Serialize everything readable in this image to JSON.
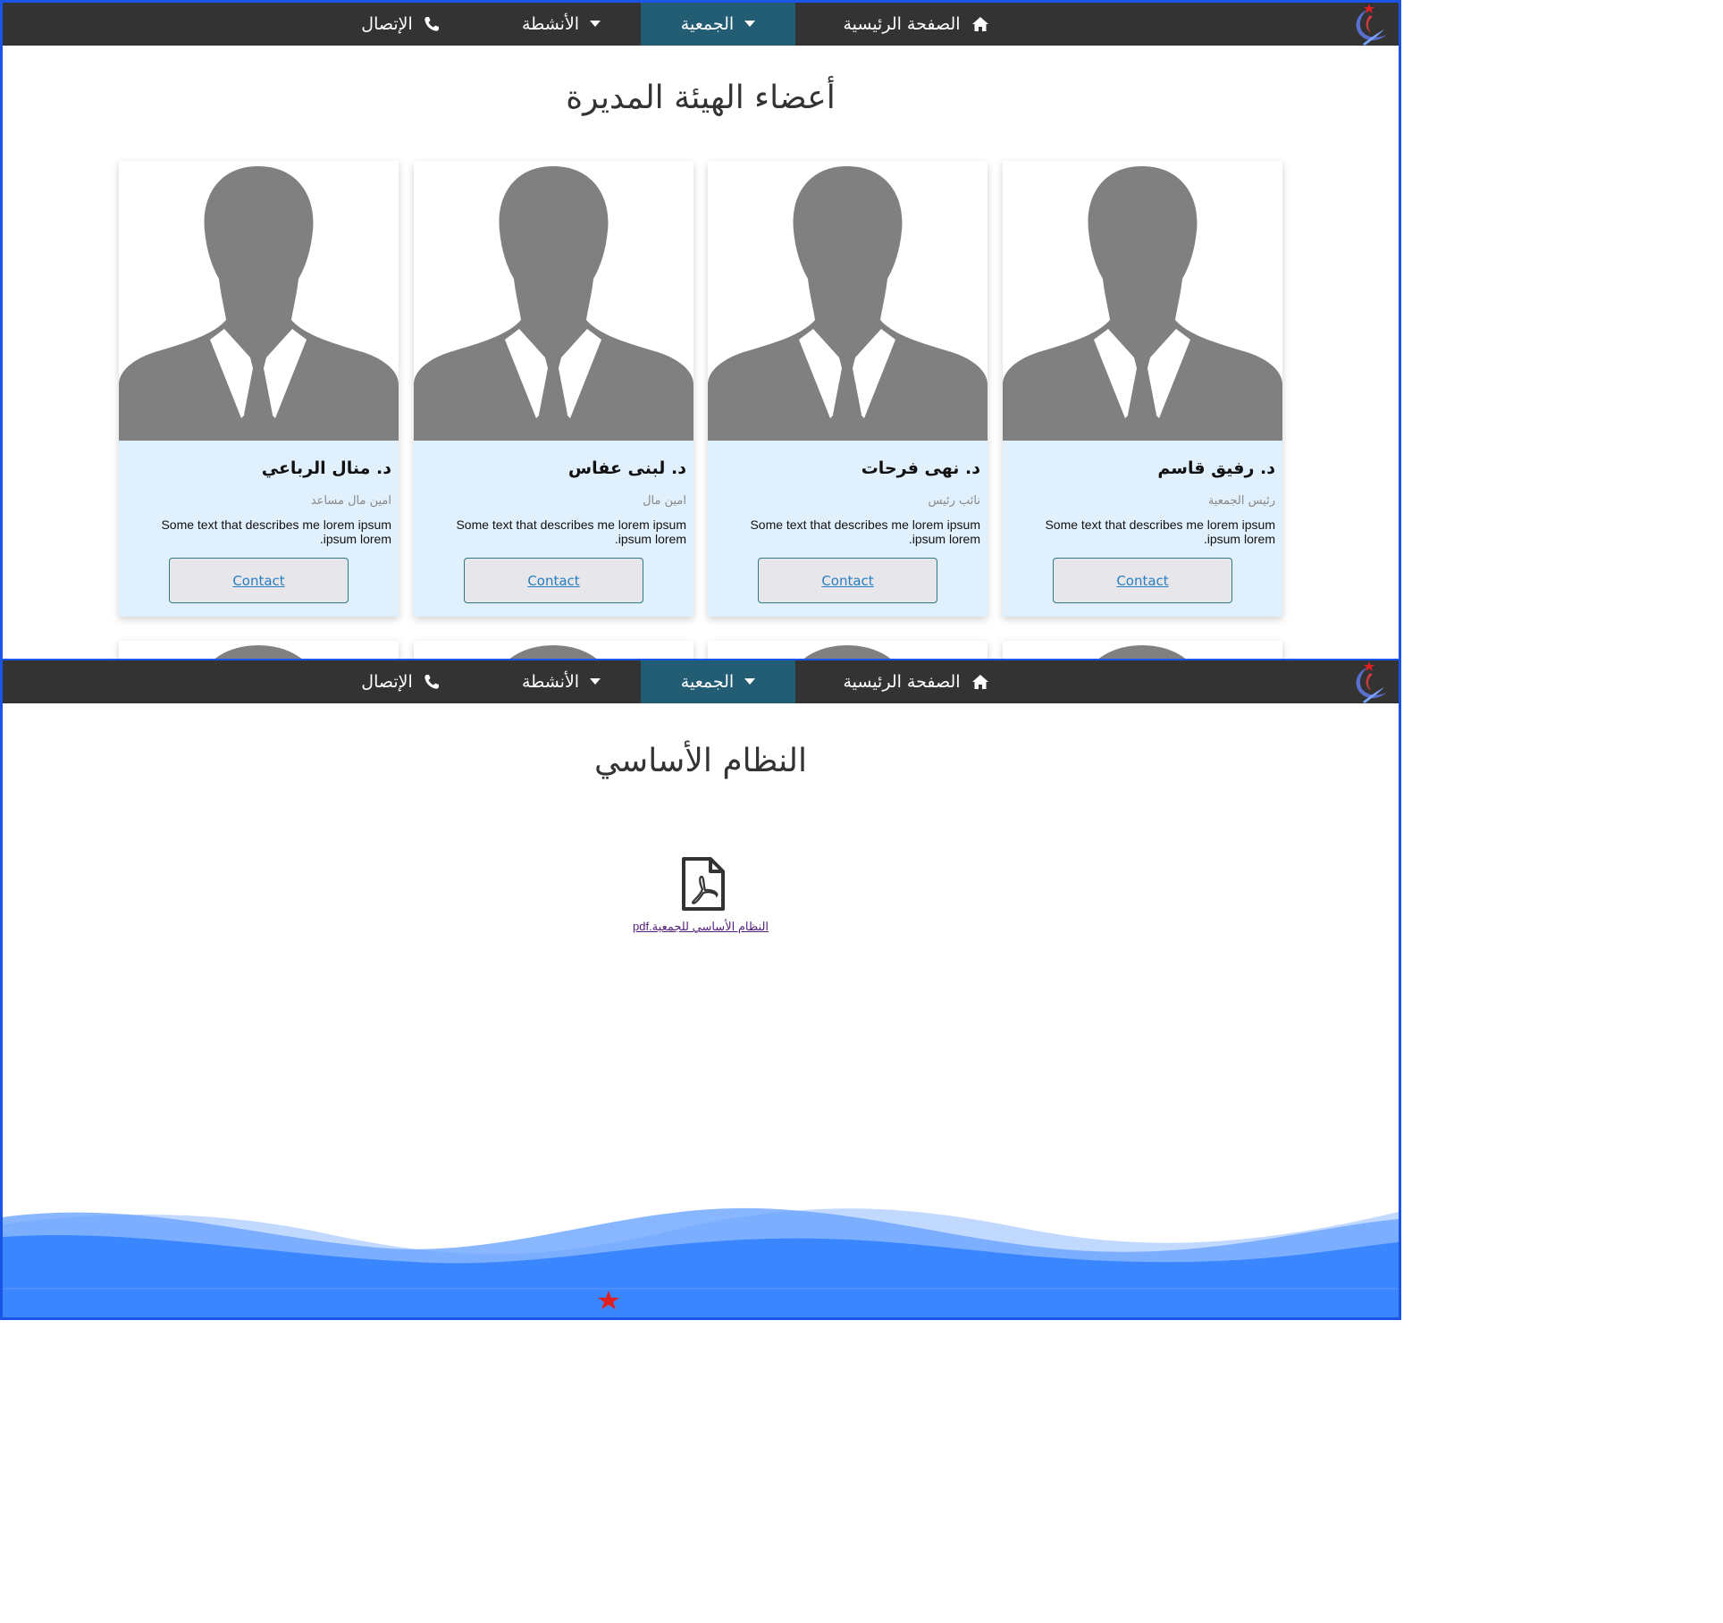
{
  "nav": {
    "home": {
      "label": "الصفحة الرئيسية",
      "icon": "home-icon"
    },
    "association": {
      "label": "الجمعية",
      "icon": "caret-down-icon"
    },
    "activities": {
      "label": "الأنشطة",
      "icon": "caret-down-icon"
    },
    "contact": {
      "label": "الإتصال",
      "icon": "phone-icon"
    },
    "active_color": "#225d73",
    "bar_color": "#333333"
  },
  "board": {
    "title": "أعضاء الهيئة المديرة",
    "members": [
      {
        "name": "د. رفيق قاسم",
        "role": "رئيس الجمعية",
        "desc": "Some text that describes me lorem ipsum ipsum lorem.",
        "button": "Contact"
      },
      {
        "name": "د. نهى فرحات",
        "role": "نائب رئيس",
        "desc": "Some text that describes me lorem ipsum ipsum lorem.",
        "button": "Contact"
      },
      {
        "name": "د. لبنى عفاس",
        "role": "امين مال",
        "desc": "Some text that describes me lorem ipsum ipsum lorem.",
        "button": "Contact"
      },
      {
        "name": "د. منال الرباعي",
        "role": "امين مال مساعد",
        "desc": "Some text that describes me lorem ipsum ipsum lorem.",
        "button": "Contact"
      }
    ]
  },
  "statute": {
    "title": "النظام الأساسي",
    "file_label": "النظام الأساسي للجمعية.pdf",
    "file_icon": "pdf-file-icon"
  },
  "colors": {
    "accent": "#1a55e8",
    "card_bg": "#e1f0fd",
    "wave": "#3a86ff"
  }
}
